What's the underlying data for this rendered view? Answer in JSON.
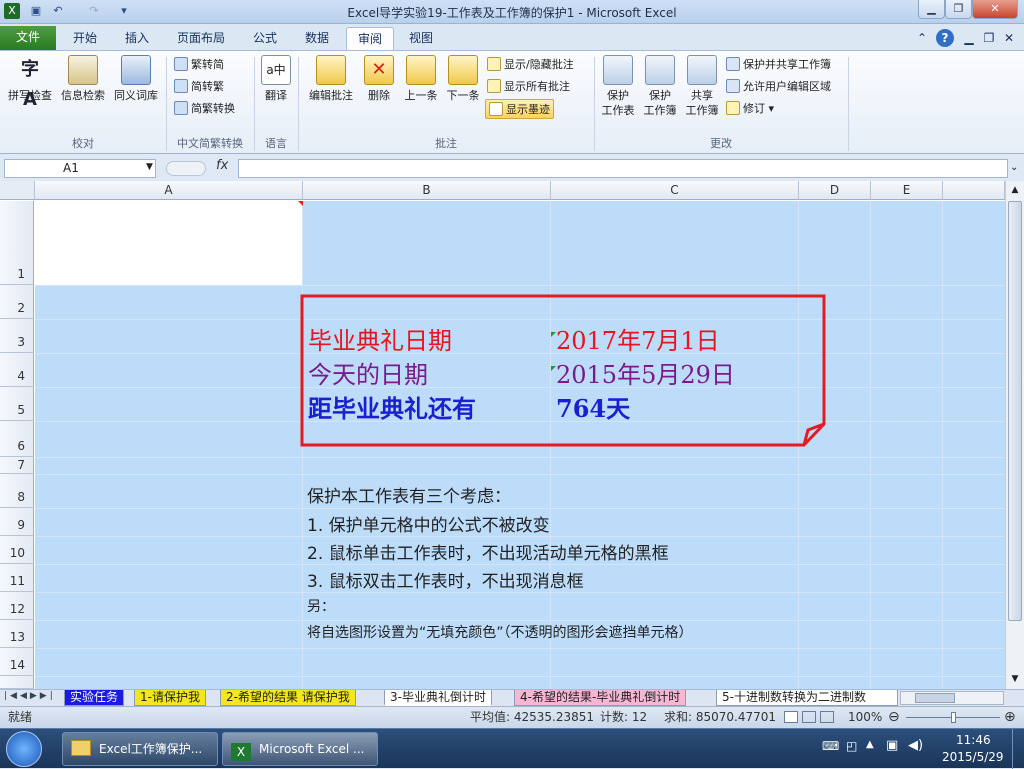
{
  "window": {
    "title": "Excel导学实验19-工作表及工作簿的保护1 - Microsoft Excel",
    "minimize_icon": "minimize-icon",
    "maximize_icon": "restore-icon",
    "close_icon": "close-icon"
  },
  "ribbon_tabs": [
    "文件",
    "开始",
    "插入",
    "页面布局",
    "公式",
    "数据",
    "审阅",
    "视图"
  ],
  "active_tab": "审阅",
  "ribbon": {
    "proofing": {
      "label": "校对",
      "buttons": [
        "拼写检查",
        "信息检索",
        "同义词库"
      ]
    },
    "chinese_conversion": {
      "label": "中文简繁转换",
      "buttons": [
        "繁转简",
        "简转繁",
        "简繁转换"
      ]
    },
    "language": {
      "label": "语言",
      "buttons": [
        "翻译"
      ]
    },
    "comments": {
      "label": "批注",
      "buttons": [
        "编辑批注",
        "删除",
        "上一条",
        "下一条"
      ],
      "small_buttons": [
        "显示/隐藏批注",
        "显示所有批注",
        "显示墨迹"
      ]
    },
    "changes": {
      "label": "更改",
      "buttons": [
        {
          "line1": "保护",
          "line2": "工作表"
        },
        {
          "line1": "保护",
          "line2": "工作簿"
        },
        {
          "line1": "共享",
          "line2": "工作簿"
        }
      ],
      "small_buttons": [
        "保护并共享工作簿",
        "允许用户编辑区域",
        "修订"
      ]
    }
  },
  "formula_bar": {
    "name_box": "A1",
    "fx_label": "fx",
    "formula": ""
  },
  "columns": [
    "A",
    "B",
    "C",
    "D",
    "E"
  ],
  "rows": [
    "1",
    "2",
    "3",
    "4",
    "5",
    "6",
    "7",
    "8",
    "9",
    "10",
    "11",
    "12",
    "13",
    "14"
  ],
  "cells": {
    "B3": "毕业典礼日期",
    "C3": "2017年7月1日",
    "B4": "今天的日期",
    "C4": "2015年5月29日",
    "B5": "距毕业典礼还有",
    "C5": "764天",
    "B8": "保护本工作表有三个考虑：",
    "B9": "1.  保护单元格中的公式不被改变",
    "B10": "2.  鼠标单击工作表时，不出现活动单元格的黑框",
    "B11": "3.  鼠标双击工作表时，不出现消息框",
    "B12": "另：",
    "B13": "将自选图形设置为“无填充颜色”（不透明的图形会遮挡单元格）"
  },
  "colors": {
    "date_red": "#e8151f",
    "date_purple": "#7a1a8c",
    "countdown_blue": "#1a1fd0",
    "shape_border": "#e31b23",
    "cell_fill": "#bddcf9"
  },
  "sheet_tabs": [
    {
      "label": "实验任务",
      "color": "#1a1ae0"
    },
    {
      "label": "1-请保护我",
      "color": "#f3e61a"
    },
    {
      "label": "2-希望的结果 请保护我",
      "color": "#f3e61a"
    },
    {
      "label": "3-毕业典礼倒计时",
      "color": "#ffffff"
    },
    {
      "label": "4-希望的结果-毕业典礼倒计时",
      "color": "#f7b7d2"
    },
    {
      "label": "5-十进制数转换为二进制数",
      "color": "#ffffff"
    }
  ],
  "status_bar": {
    "mode": "就绪",
    "average": "平均值: 42535.23851",
    "count": "计数: 12",
    "sum": "求和: 85070.47701",
    "zoom": "100%"
  },
  "taskbar": {
    "start_icon": "windows-start-icon",
    "items": [
      "Excel工作簿保护...",
      "Microsoft Excel ..."
    ],
    "time": "11:46",
    "date": "2015/5/29"
  }
}
